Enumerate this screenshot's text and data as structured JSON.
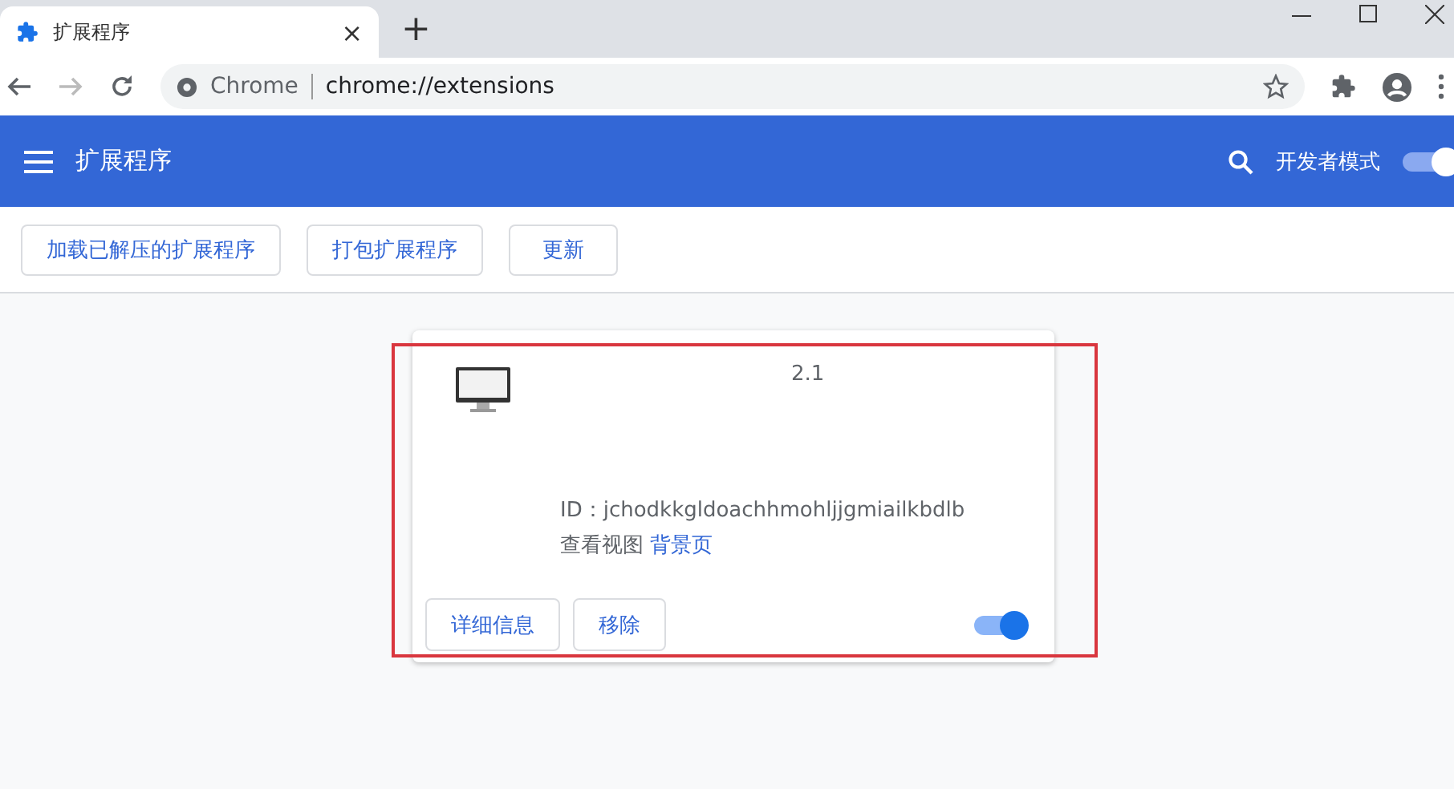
{
  "tab": {
    "title": "扩展程序",
    "close": "×",
    "new_tab": "+"
  },
  "address_bar": {
    "site": "Chrome",
    "url": "chrome://extensions"
  },
  "header": {
    "title": "扩展程序",
    "dev_mode_label": "开发者模式",
    "dev_mode_on": true
  },
  "actions": [
    "加载已解压的扩展程序",
    "打包扩展程序",
    "更新"
  ],
  "extension": {
    "version": "2.1",
    "id_label": "ID：",
    "id": "jchodkkgldoachhmohljjgmiailkbdlb",
    "views_label": "查看视图",
    "view_link": "背景页",
    "buttons": [
      "详细信息",
      "移除"
    ],
    "enabled": true
  }
}
